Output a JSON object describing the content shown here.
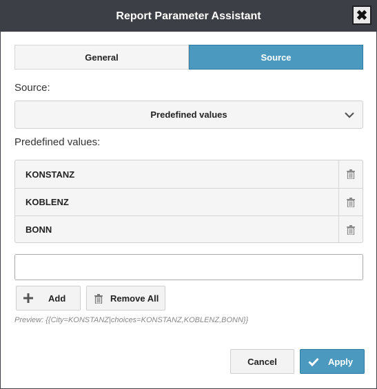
{
  "dialog": {
    "title": "Report Parameter Assistant",
    "close_icon": "close-icon"
  },
  "tabs": [
    {
      "label": "General",
      "active": false
    },
    {
      "label": "Source",
      "active": true
    }
  ],
  "source": {
    "label": "Source:",
    "selected": "Predefined values",
    "dropdown_icon": "chevron-down-icon"
  },
  "predefined": {
    "label": "Predefined values:",
    "items": [
      "KONSTANZ",
      "KOBLENZ",
      "BONN"
    ],
    "delete_icon": "trash-icon"
  },
  "new_value": {
    "value": "",
    "placeholder": ""
  },
  "actions": {
    "add_label": "Add",
    "add_icon": "plus-icon",
    "remove_all_label": "Remove All",
    "remove_all_icon": "trash-icon"
  },
  "preview": "Preview: {{City=KONSTANZ|choices=KONSTANZ,KOBLENZ,BONN}}",
  "footer": {
    "cancel_label": "Cancel",
    "apply_label": "Apply",
    "apply_icon": "checkmark-icon"
  },
  "colors": {
    "titlebar": "#3c3f45",
    "accent": "#4b99bf"
  }
}
